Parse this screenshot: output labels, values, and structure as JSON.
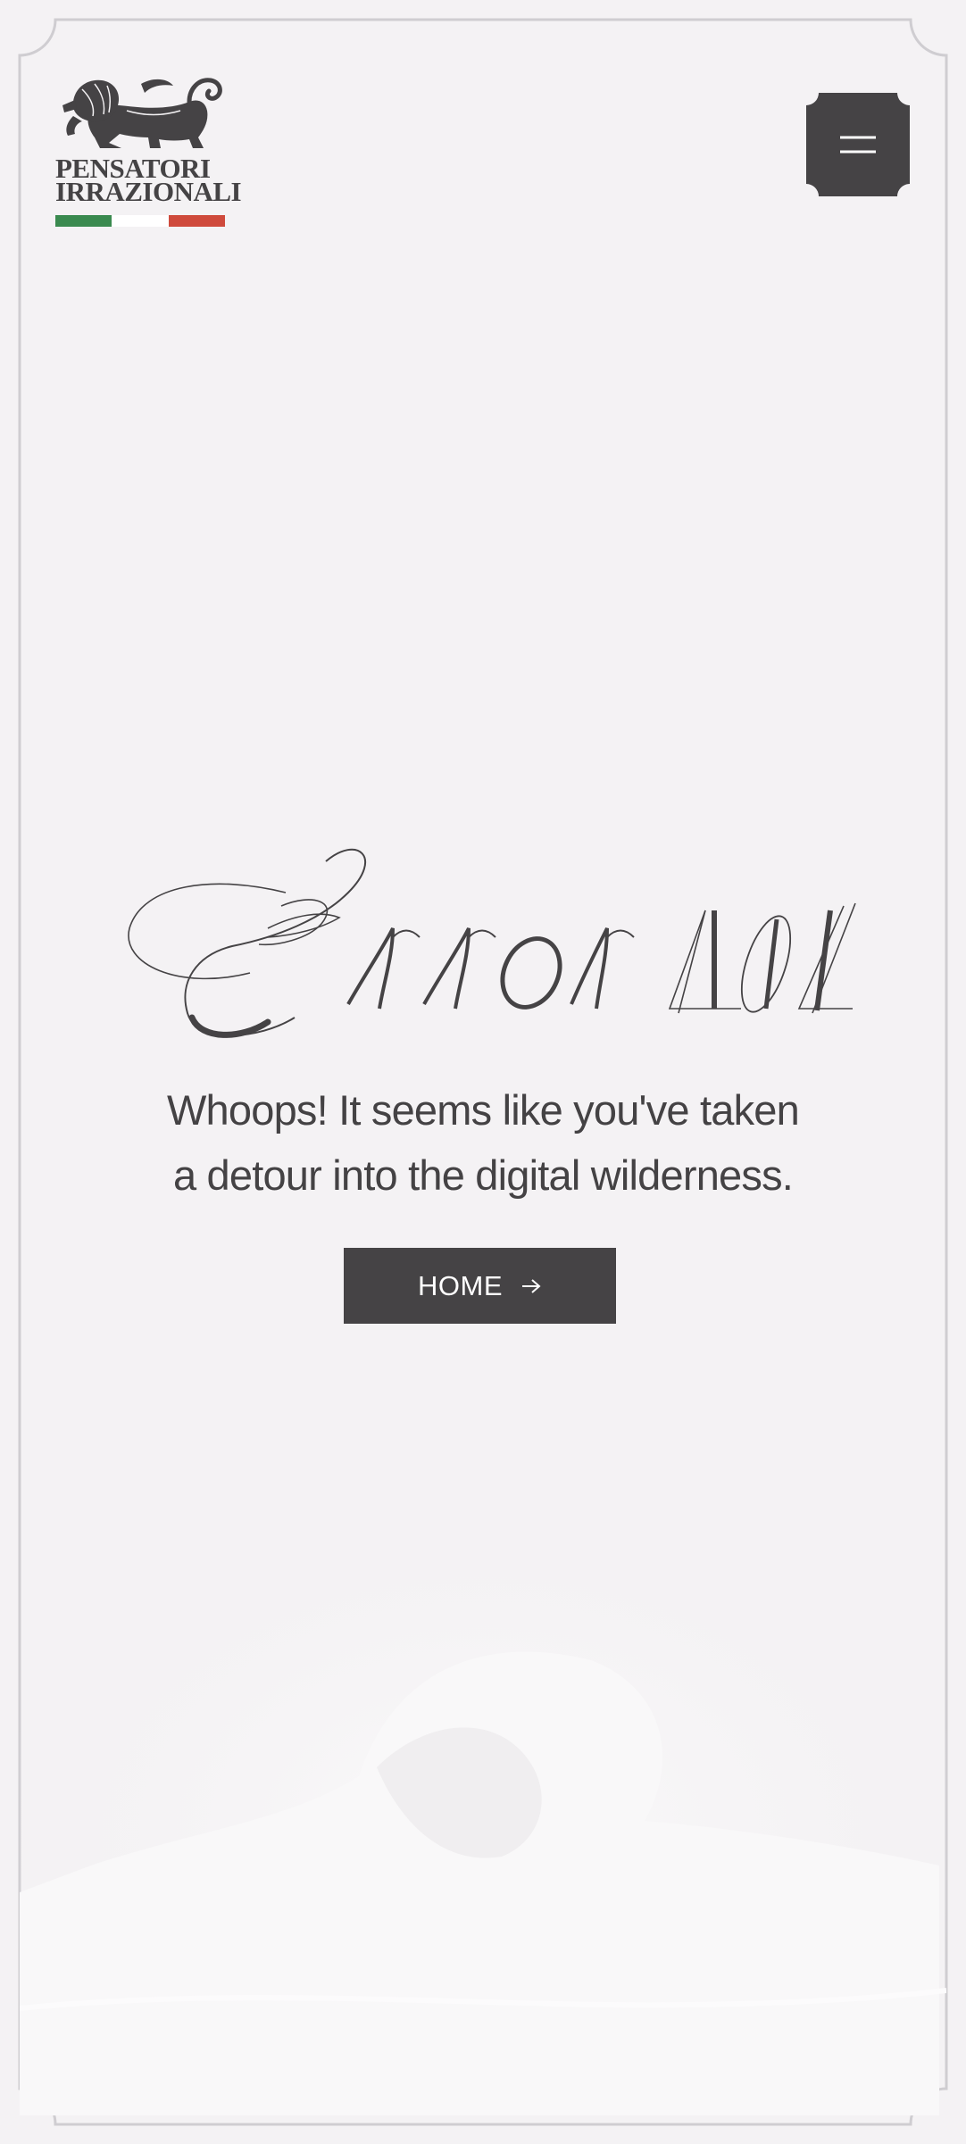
{
  "brand": {
    "line1": "PENSATORI",
    "line2": "IRRAZIONALI",
    "logo_icon": "lion-rampant-icon",
    "flag_colors": [
      "#3a8a4f",
      "#ffffff",
      "#cf4a3c"
    ]
  },
  "header": {
    "menu_icon": "hamburger-menu-icon"
  },
  "main": {
    "title": "Error 404",
    "message_line1": "Whoops! It seems like you've taken",
    "message_line2": "a detour into the digital wilderness.",
    "home_button_label": "HOME",
    "home_button_icon": "arrow-right-icon"
  },
  "colors": {
    "background": "#f4f2f4",
    "dark": "#454345",
    "frame": "#cfcdd1"
  }
}
